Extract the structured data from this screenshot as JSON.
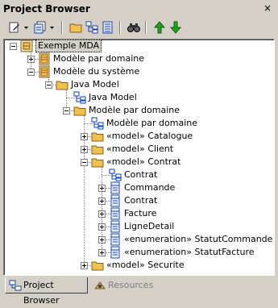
{
  "window": {
    "title": "Project Browser",
    "close_glyph": "×"
  },
  "toolbar": {
    "buttons": [
      {
        "icon": "new-element-icon"
      },
      {
        "icon": "add-diagram-icon"
      },
      {
        "icon": "new-package-icon"
      },
      {
        "icon": "add-element-icon"
      },
      {
        "icon": "properties-icon"
      },
      {
        "icon": "find-icon"
      },
      {
        "icon": "move-up-icon"
      },
      {
        "icon": "move-down-icon"
      }
    ]
  },
  "tree": {
    "nodes": [
      {
        "label": "Exemple MDA",
        "depth": 0,
        "expander": "minus",
        "icon": "root-model-icon",
        "selected": true
      },
      {
        "label": "Modèle par domaine",
        "depth": 1,
        "expander": "plus",
        "icon": "model-icon"
      },
      {
        "label": "Modèle du système",
        "depth": 1,
        "expander": "minus",
        "icon": "model-icon"
      },
      {
        "label": "Java Model",
        "depth": 2,
        "expander": "minus",
        "icon": "folder-icon"
      },
      {
        "label": "Java Model",
        "depth": 3,
        "expander": "none",
        "icon": "diagram-icon"
      },
      {
        "label": "Modèle par domaine",
        "depth": 3,
        "expander": "minus",
        "icon": "folder-icon"
      },
      {
        "label": "Modèle par domaine",
        "depth": 4,
        "expander": "none",
        "icon": "diagram-icon"
      },
      {
        "label": "«model» Catalogue",
        "depth": 4,
        "expander": "plus",
        "icon": "folder-icon"
      },
      {
        "label": "«model» Client",
        "depth": 4,
        "expander": "plus",
        "icon": "folder-icon"
      },
      {
        "label": "«model» Contrat",
        "depth": 4,
        "expander": "minus",
        "icon": "folder-icon"
      },
      {
        "label": "Contrat",
        "depth": 5,
        "expander": "none",
        "icon": "diagram-icon"
      },
      {
        "label": "Commande",
        "depth": 5,
        "expander": "plus",
        "icon": "class-icon"
      },
      {
        "label": "Contrat",
        "depth": 5,
        "expander": "plus",
        "icon": "class-icon"
      },
      {
        "label": "Facture",
        "depth": 5,
        "expander": "plus",
        "icon": "class-icon"
      },
      {
        "label": "LigneDetail",
        "depth": 5,
        "expander": "plus",
        "icon": "class-icon"
      },
      {
        "label": "«enumeration» StatutCommande",
        "depth": 5,
        "expander": "plus",
        "icon": "class-icon"
      },
      {
        "label": "«enumeration» StatutFacture",
        "depth": 5,
        "expander": "plus",
        "icon": "class-icon"
      },
      {
        "label": "«model» Securite",
        "depth": 4,
        "expander": "plus",
        "icon": "folder-icon"
      }
    ]
  },
  "tabs": [
    {
      "label": "Project Browser",
      "active": true,
      "icon": "project-browser-icon"
    },
    {
      "label": "Resources",
      "active": false,
      "icon": "resources-icon"
    }
  ],
  "colors": {
    "face": "#d4d0c8",
    "folder": "#f0c050",
    "diagram": "#0040c0",
    "class": "#1848b0",
    "green": "#20a020"
  }
}
